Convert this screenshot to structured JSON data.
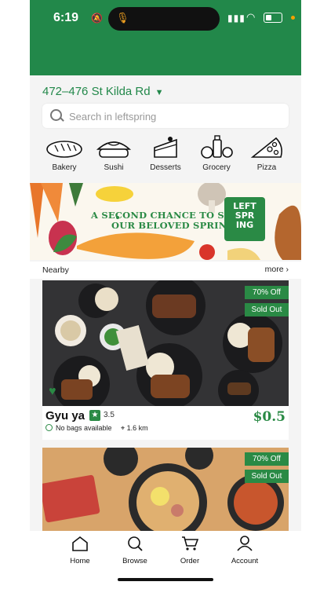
{
  "status": {
    "time": "6:19"
  },
  "location": {
    "address": "472–476 St Kilda Rd"
  },
  "search": {
    "placeholder": "Search in leftspring"
  },
  "categories": [
    {
      "label": "Bakery",
      "icon": "bread-icon"
    },
    {
      "label": "Sushi",
      "icon": "sushi-icon"
    },
    {
      "label": "Desserts",
      "icon": "cake-icon"
    },
    {
      "label": "Grocery",
      "icon": "grocery-icon"
    },
    {
      "label": "Pizza",
      "icon": "pizza-icon"
    }
  ],
  "banner": {
    "line1": "A SECOND CHANCE TO SEE",
    "line2": "OUR BELOVED SPRING",
    "logo_lines": [
      "LEFT",
      "SPR",
      "ING"
    ]
  },
  "nearby": {
    "heading": "Nearby",
    "more": "more"
  },
  "listings": [
    {
      "name": "Gyu ya",
      "rating": "3.5",
      "availability": "No bags available",
      "distance": "1.6 km",
      "price": "$0.5",
      "discount": "70% Off",
      "status": "Sold Out"
    },
    {
      "discount": "70% Off",
      "status": "Sold Out"
    }
  ],
  "tabs": [
    {
      "label": "Home",
      "icon": "home-icon"
    },
    {
      "label": "Browse",
      "icon": "search-icon"
    },
    {
      "label": "Order",
      "icon": "cart-icon"
    },
    {
      "label": "Account",
      "icon": "user-icon"
    }
  ],
  "colors": {
    "brand": "#22884a",
    "accent": "#2a8a45",
    "background": "#f4f4f4"
  }
}
